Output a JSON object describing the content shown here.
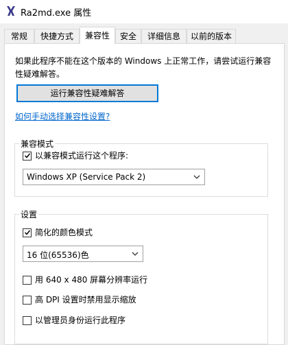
{
  "window": {
    "title": "Ra2md.exe 属性",
    "icon": "app-icon"
  },
  "tabs": [
    {
      "label": "常规",
      "active": false
    },
    {
      "label": "快捷方式",
      "active": false
    },
    {
      "label": "兼容性",
      "active": true
    },
    {
      "label": "安全",
      "active": false
    },
    {
      "label": "详细信息",
      "active": false
    },
    {
      "label": "以前的版本",
      "active": false
    }
  ],
  "intro": "如果此程序不能在这个版本的 Windows 上正常工作，请尝试运行兼容性疑难解答。",
  "troubleshoot_button": "运行兼容性疑难解答",
  "manual_link": "如何手动选择兼容性设置?",
  "compat_mode": {
    "label": "兼容模式",
    "checkbox_label": "以兼容模式运行这个程序:",
    "checked": true,
    "selected_os": "Windows XP (Service Pack 2)"
  },
  "settings": {
    "label": "设置",
    "reduced_color": {
      "label": "简化的颜色模式",
      "checked": true
    },
    "color_depth": "16 位(65536)色",
    "run_640": {
      "label": "用 640 x 480 屏幕分辨率运行",
      "checked": false
    },
    "high_dpi": {
      "label": "高 DPI 设置时禁用显示缩放",
      "checked": false
    },
    "run_admin": {
      "label": "以管理员身份运行此程序",
      "checked": false
    }
  },
  "colors": {
    "accent": "#0078d7",
    "link": "#0066cc"
  }
}
